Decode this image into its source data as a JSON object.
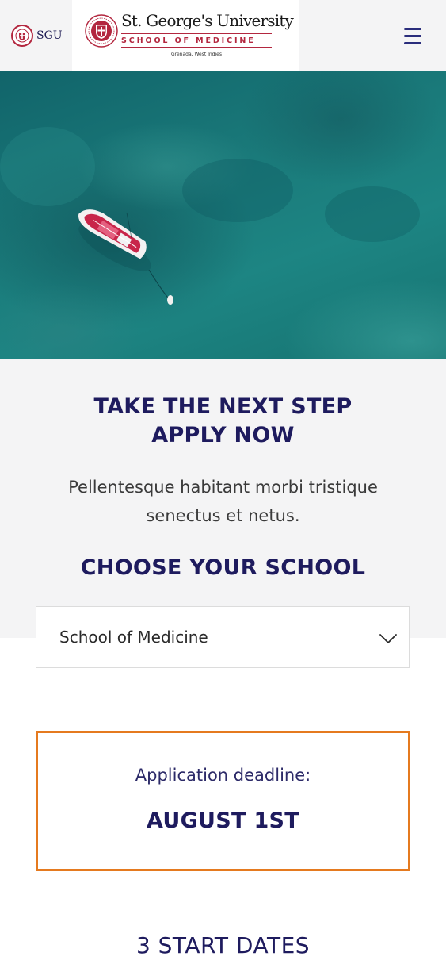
{
  "header": {
    "short_logo_text": "SGU",
    "logo": {
      "name": "St. George's University",
      "school": "SCHOOL OF MEDICINE",
      "location": "Grenada, West Indies"
    },
    "menu_icon": "hamburger-menu-icon"
  },
  "hero": {
    "image_subject": "aerial view of a small boat on turquoise water"
  },
  "apply": {
    "headline_line1": "TAKE THE NEXT STEP",
    "headline_line2": "APPLY NOW",
    "lead_text": "Pellentesque habitant morbi tristique senectus et netus.",
    "choose_title": "CHOOSE YOUR SCHOOL",
    "school_select": {
      "selected": "School of Medicine",
      "icon": "chevron-down-icon"
    }
  },
  "deadline": {
    "label": "Application deadline:",
    "date": "AUGUST 1ST"
  },
  "start_dates": {
    "title": "3 START DATES"
  },
  "colors": {
    "brand_navy": "#1e1b5e",
    "brand_red": "#b3273f",
    "accent_orange": "#e57a1f",
    "section_gray": "#f4f4f5"
  }
}
